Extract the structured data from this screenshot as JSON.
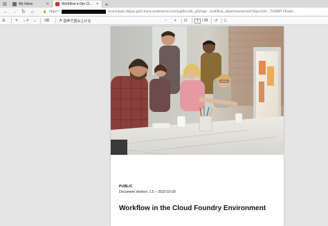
{
  "browser": {
    "tabs": [
      {
        "title": "My Inbox",
        "favicon_color": "#6a6a6a",
        "active": false
      },
      {
        "title": "Workflow in the Cloud Foundry E",
        "favicon_color": "#c8392b",
        "active": true
      }
    ],
    "url_prefix": "https://",
    "url": "launchpad.cfapps.jp10.hana.ondemand.com/sap/bc/ui5_ui5/sap/...workflow_attachments/root?objectId=...TGMMTXKwke..."
  },
  "pdf_toolbar": {
    "read_aloud_label": "音声で読み上げる",
    "current_page": "1",
    "total_pages": "/ 39"
  },
  "document": {
    "classification": "PUBLIC",
    "version": "Document Version: 1.0 – 2022-02-09",
    "title": "Workflow in the Cloud Foundry Environment"
  },
  "colors": {
    "tab_strip": "#d9d9d9",
    "toolbar": "#f9f9f9",
    "viewer_background": "#e5e5e5",
    "redaction": "#0c0c0c"
  }
}
